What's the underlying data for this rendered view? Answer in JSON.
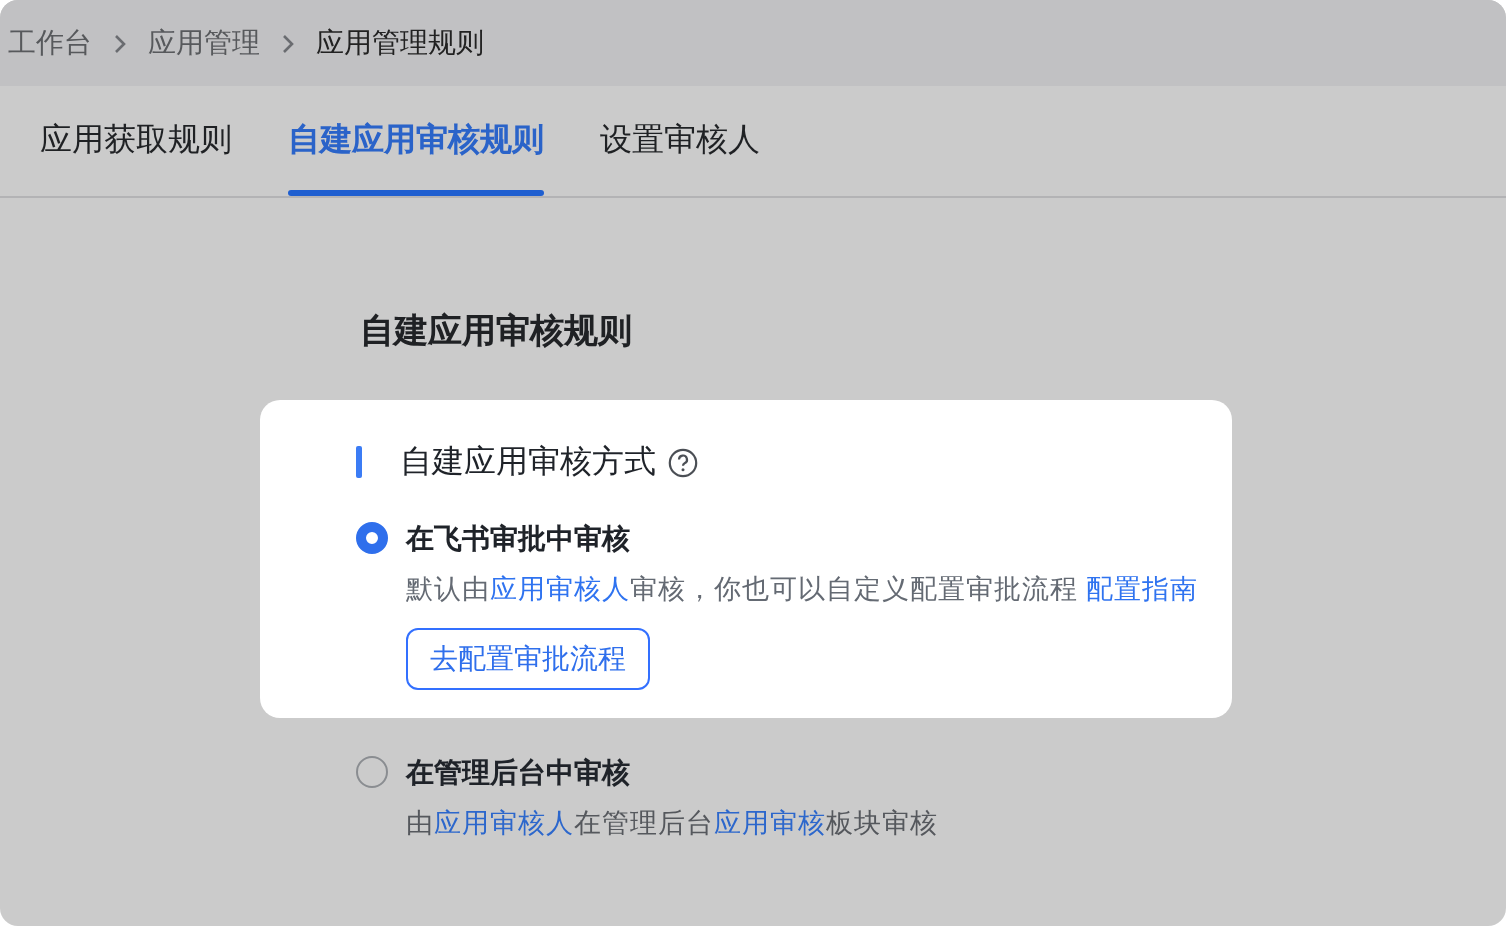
{
  "breadcrumb": [
    "工作台",
    "应用管理",
    "应用管理规则"
  ],
  "tabs": [
    {
      "label": "应用获取规则",
      "selected": false
    },
    {
      "label": "自建应用审核规则",
      "selected": true
    },
    {
      "label": "设置审核人",
      "selected": false
    }
  ],
  "heading": "自建应用审核规则",
  "section": {
    "title": "自建应用审核方式",
    "spotlighted": true
  },
  "options": [
    {
      "title": "在飞书审批中审核",
      "selected": true,
      "spotlighted": true,
      "description": [
        {
          "kind": "plain",
          "text": "默认由"
        },
        {
          "kind": "link",
          "text": "应用审核人"
        },
        {
          "kind": "plain",
          "text": "审核，你也可以自定义配置审批流程 "
        },
        {
          "kind": "link",
          "text": "配置指南"
        }
      ],
      "button": "去配置审批流程"
    },
    {
      "title": "在管理后台中审核",
      "selected": false,
      "spotlighted": false,
      "description": [
        {
          "kind": "plain",
          "text": "由"
        },
        {
          "kind": "link",
          "text": "应用审核人"
        },
        {
          "kind": "plain",
          "text": "在管理后台"
        },
        {
          "kind": "link",
          "text": "应用审核"
        },
        {
          "kind": "plain",
          "text": "板块审核"
        }
      ]
    }
  ]
}
